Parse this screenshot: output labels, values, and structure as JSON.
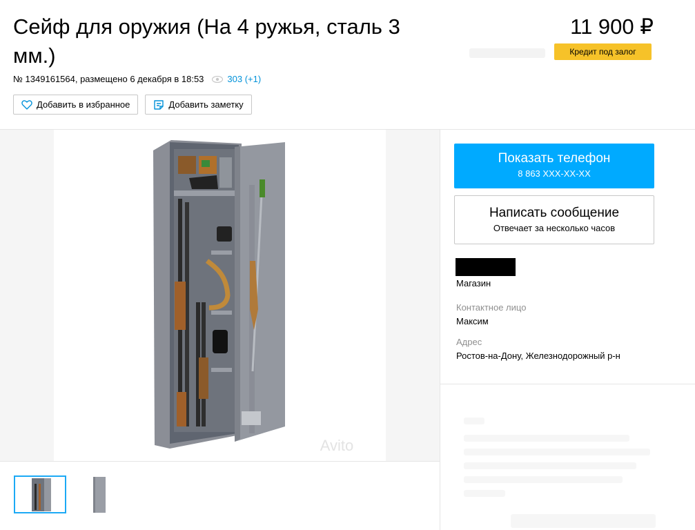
{
  "listing": {
    "title": "Сейф для оружия (На 4 ружья, сталь 3 мм.)",
    "meta_text": "№ 1349161564, размещено 6 декабря в 18:53",
    "views": "303 (+1)",
    "price": "11 900 ₽",
    "credit_label": "Кредит под залог"
  },
  "actions": {
    "favorite_label": "Добавить в избранное",
    "note_label": "Добавить заметку"
  },
  "gallery": {
    "watermark": "Avito"
  },
  "contact": {
    "phone_title": "Показать телефон",
    "phone_number": "8 863 XXX-XX-XX",
    "message_title": "Написать сообщение",
    "message_sub": "Отвечает за несколько часов",
    "seller_type": "Магазин",
    "contact_label": "Контактное лицо",
    "contact_name": "Максим",
    "address_label": "Адрес",
    "address_value": "Ростов-на-Дону, Железнодорожный р-н"
  },
  "colors": {
    "accent_blue": "#00aaff",
    "credit_yellow": "#f6c229",
    "link_blue": "#0091d9"
  }
}
